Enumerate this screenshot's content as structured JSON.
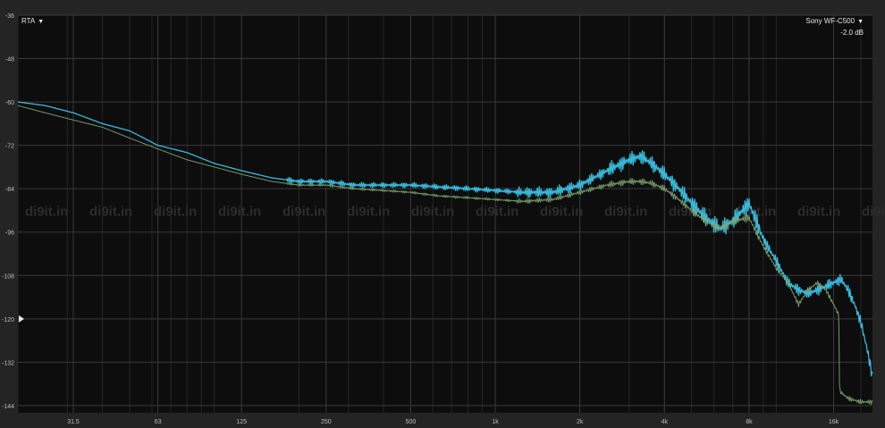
{
  "header": {
    "rta_label": "RTA",
    "device_label": "Sony WF-C500",
    "gain_label": "-2.0 dB"
  },
  "watermark": "di9it.in",
  "colors": {
    "background": "#0d0d0d",
    "frame": "#242424",
    "grid": "#3a3a3a",
    "series_cyan": "#3bc3e6",
    "series_green": "#7fa873"
  },
  "chart_data": {
    "type": "line",
    "x_scale": "log",
    "xlim": [
      20,
      22000
    ],
    "ylim": [
      -146,
      -36
    ],
    "grid": true,
    "x_ticks": [
      {
        "value": 31.5,
        "label": "31.5"
      },
      {
        "value": 63,
        "label": "63"
      },
      {
        "value": 125,
        "label": "125"
      },
      {
        "value": 250,
        "label": "250"
      },
      {
        "value": 500,
        "label": "500"
      },
      {
        "value": 1000,
        "label": "1k"
      },
      {
        "value": 2000,
        "label": "2k"
      },
      {
        "value": 4000,
        "label": "4k"
      },
      {
        "value": 8000,
        "label": "8k"
      },
      {
        "value": 16000,
        "label": "16k"
      }
    ],
    "y_ticks": [
      -36,
      -48,
      -60,
      -72,
      -84,
      -96,
      -108,
      -120,
      -132,
      -144
    ],
    "marker_level": -120,
    "series": [
      {
        "color": "#3bc3e6",
        "x": [
          20,
          25,
          31.5,
          40,
          50,
          63,
          80,
          100,
          125,
          160,
          200,
          250,
          315,
          400,
          500,
          630,
          800,
          1000,
          1250,
          1600,
          2000,
          2500,
          3000,
          3300,
          3600,
          4000,
          4500,
          5000,
          5600,
          6300,
          7000,
          8000,
          9000,
          10000,
          11000,
          12000,
          13000,
          14000,
          15000,
          16000,
          17000,
          18000,
          19000,
          20000,
          21000,
          22000
        ],
        "y": [
          -60,
          -61,
          -63,
          -66,
          -68,
          -72,
          -74,
          -77,
          -79,
          -81,
          -82,
          -82,
          -83,
          -83,
          -83,
          -83.5,
          -84,
          -84.5,
          -85,
          -85,
          -83,
          -79,
          -76,
          -75,
          -77,
          -80,
          -84,
          -88,
          -92,
          -95,
          -93,
          -88,
          -98,
          -104,
          -110,
          -112,
          -113,
          -112,
          -111,
          -110,
          -109,
          -112,
          -116,
          -121,
          -128,
          -136
        ]
      },
      {
        "color": "#7fa873",
        "x": [
          20,
          25,
          31.5,
          40,
          50,
          63,
          80,
          100,
          125,
          160,
          200,
          250,
          315,
          400,
          500,
          630,
          800,
          1000,
          1250,
          1600,
          2000,
          2500,
          3000,
          3300,
          3600,
          4000,
          4500,
          5000,
          5600,
          6300,
          7000,
          8000,
          9000,
          10000,
          11000,
          12000,
          13000,
          14000,
          15000,
          16000,
          16700,
          16800,
          18000,
          20000,
          22000
        ],
        "y": [
          -61,
          -63,
          -65,
          -67,
          -70,
          -73,
          -76,
          -78,
          -80,
          -82,
          -83,
          -83,
          -84,
          -84.5,
          -85,
          -86,
          -86.5,
          -87,
          -87.5,
          -87,
          -85,
          -83,
          -82,
          -82,
          -82.5,
          -84,
          -87,
          -90,
          -93,
          -95,
          -93,
          -92,
          -100,
          -106,
          -110,
          -116,
          -112,
          -110,
          -112,
          -116,
          -119,
          -140,
          -142,
          -143,
          -143
        ]
      }
    ]
  }
}
